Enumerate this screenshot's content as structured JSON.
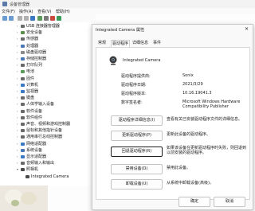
{
  "device_manager": {
    "title": "设备管理器",
    "menu": [
      "文件(F)",
      "操作(A)",
      "查看(V)",
      "帮助(H)"
    ],
    "tree": [
      {
        "label": "USB 连接器管理器",
        "level": 0,
        "icon": "usb-icon",
        "color": "#6a6a6a"
      },
      {
        "label": "安全设备",
        "level": 0,
        "icon": "security-device-icon",
        "color": "#5a8f4a"
      },
      {
        "label": "传感器",
        "level": 0,
        "icon": "sensor-icon",
        "color": "#6a6a6a"
      },
      {
        "label": "处理器",
        "level": 0,
        "icon": "processor-icon",
        "color": "#4a7ab5"
      },
      {
        "label": "磁盘驱动器",
        "level": 0,
        "icon": "disk-drive-icon",
        "color": "#8a8a8a"
      },
      {
        "label": "存储控制器",
        "level": 0,
        "icon": "storage-controller-icon",
        "color": "#4a7ab5"
      },
      {
        "label": "打印队列",
        "level": 0,
        "icon": "printer-icon",
        "color": "#6a6a6a"
      },
      {
        "label": "电池",
        "level": 0,
        "icon": "battery-icon",
        "color": "#5a9a5a"
      },
      {
        "label": "固件",
        "level": 0,
        "icon": "firmware-icon",
        "color": "#6a6a6a"
      },
      {
        "label": "计算机",
        "level": 0,
        "icon": "computer-icon",
        "color": "#3a78c2"
      },
      {
        "label": "监视器",
        "level": 0,
        "icon": "monitor-icon",
        "color": "#3a78c2"
      },
      {
        "label": "键盘",
        "level": 0,
        "icon": "keyboard-icon",
        "color": "#6a6a6a"
      },
      {
        "label": "人体学输入设备",
        "level": 0,
        "icon": "hid-icon",
        "color": "#6a6a6a"
      },
      {
        "label": "软件设备",
        "level": 0,
        "icon": "software-device-icon",
        "color": "#6a6a6a"
      },
      {
        "label": "软件组件",
        "level": 0,
        "icon": "software-component-icon",
        "color": "#6a6a6a"
      },
      {
        "label": "声音、视频和游戏控制器",
        "level": 0,
        "icon": "sound-icon",
        "color": "#6a6a6a"
      },
      {
        "label": "鼠标和其他指针设备",
        "level": 0,
        "icon": "mouse-icon",
        "color": "#6a6a6a"
      },
      {
        "label": "通用串行总线控制器",
        "level": 0,
        "icon": "usb-controller-icon",
        "color": "#6a6a6a"
      },
      {
        "label": "网络适配器",
        "level": 0,
        "icon": "network-adapter-icon",
        "color": "#3a78c2"
      },
      {
        "label": "系统设备",
        "level": 0,
        "icon": "system-device-icon",
        "color": "#4a7ab5"
      },
      {
        "label": "显示适配器",
        "level": 0,
        "icon": "display-adapter-icon",
        "color": "#3a78c2"
      },
      {
        "label": "音频输入和输出",
        "level": 0,
        "icon": "audio-io-icon",
        "color": "#6a6a6a"
      },
      {
        "label": "照相机",
        "level": 0,
        "icon": "camera-icon",
        "color": "#4a4a4a",
        "expanded": true
      },
      {
        "label": "Integrated Camera",
        "level": 1,
        "icon": "camera-icon",
        "color": "#4a4a4a"
      }
    ]
  },
  "dialog": {
    "title": "Integrated Camera 属性",
    "close_glyph": "✕",
    "tabs": [
      {
        "label": "常规",
        "active": false
      },
      {
        "label": "驱动程序",
        "active": true
      },
      {
        "label": "详细信息",
        "active": false
      },
      {
        "label": "事件",
        "active": false
      }
    ],
    "device_name": "Integrated Camera",
    "properties": [
      {
        "key": "驱动程序提供商:",
        "value": "Sonix"
      },
      {
        "key": "驱动程序日期:",
        "value": "2021/3/29"
      },
      {
        "key": "驱动程序版本:",
        "value": "10.16.19041.3"
      },
      {
        "key": "数字签名者:",
        "value": "Microsoft Windows Hardware Compatibility Publisher"
      }
    ],
    "actions": [
      {
        "button": "驱动程序详细信息(I)",
        "desc": "查看有关已安装驱动程序文件的详细信息。"
      },
      {
        "button": "更新驱动程序(P)",
        "desc": "更新此设备的驱动程序。"
      },
      {
        "button": "回退驱动程序(R)",
        "desc": "如果该设备在更新驱动程序时失败，则回退到以前安装的驱动程序。"
      },
      {
        "button": "禁用设备(D)",
        "desc": "禁用此设备。"
      },
      {
        "button": "卸载设备(U)",
        "desc": "从系统中卸载设备(高级)。"
      }
    ],
    "ok_label": "确定",
    "cancel_label": "取消"
  }
}
